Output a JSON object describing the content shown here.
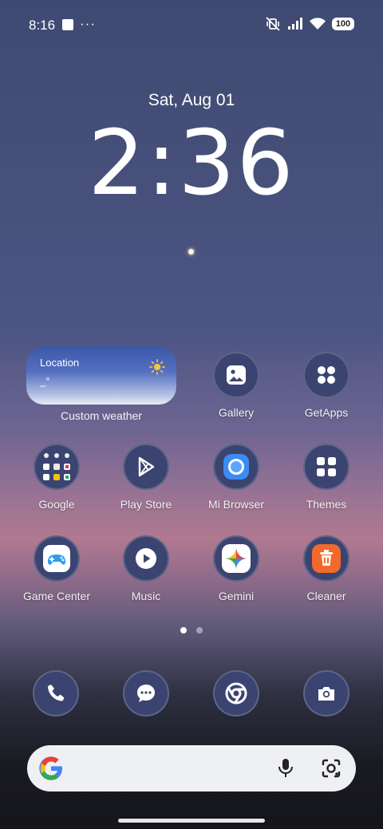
{
  "status_bar": {
    "time": "8:16",
    "dots": "···",
    "battery": "100",
    "icons": [
      "notification-square-icon",
      "mute-vibrate-icon",
      "signal-icon",
      "wifi-icon",
      "battery-icon"
    ]
  },
  "lockclock": {
    "date": "Sat, Aug 01",
    "time": "2:36"
  },
  "weather_widget": {
    "location": "Location",
    "temp": "_°",
    "icon": "sun-icon",
    "label": "Custom weather"
  },
  "apps": {
    "gallery": "Gallery",
    "getapps": "GetApps",
    "google": "Google",
    "playstore": "Play Store",
    "mibrowser": "Mi Browser",
    "themes": "Themes",
    "gamecenter": "Game Center",
    "music": "Music",
    "gemini": "Gemini",
    "cleaner": "Cleaner"
  },
  "page_indicator": {
    "current": 1,
    "total": 2
  },
  "dock": [
    "phone-icon",
    "messages-icon",
    "chrome-icon",
    "camera-icon"
  ],
  "search_bar": {
    "icons": [
      "google-g-icon",
      "microphone-icon",
      "google-lens-icon"
    ]
  },
  "colors": {
    "icon_bg": "#3b4470",
    "cleaner_orange": "#f2692b",
    "weather_blue": "#3b57a7"
  }
}
